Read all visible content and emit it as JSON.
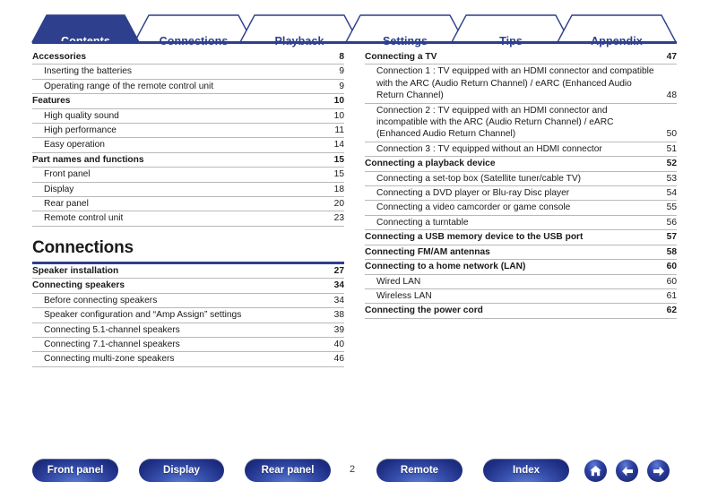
{
  "colors": {
    "brand_blue": "#2d3f8d",
    "rule_gray": "#b9b9b9",
    "text": "#1a1a1a",
    "tab_active_bg": "#2d3f8d",
    "tab_active_text": "#ffffff"
  },
  "tabs": [
    {
      "label": "Contents",
      "active": true
    },
    {
      "label": "Connections",
      "active": false
    },
    {
      "label": "Playback",
      "active": false
    },
    {
      "label": "Settings",
      "active": false
    },
    {
      "label": "Tips",
      "active": false
    },
    {
      "label": "Appendix",
      "active": false
    }
  ],
  "left_column": {
    "rows_top": [
      {
        "level": 1,
        "title": "Accessories",
        "page": "8"
      },
      {
        "level": 2,
        "title": "Inserting the batteries",
        "page": "9"
      },
      {
        "level": 2,
        "title": "Operating range of the remote control unit",
        "page": "9"
      },
      {
        "level": 1,
        "title": "Features",
        "page": "10"
      },
      {
        "level": 2,
        "title": "High quality sound",
        "page": "10"
      },
      {
        "level": 2,
        "title": "High performance",
        "page": "11"
      },
      {
        "level": 2,
        "title": "Easy operation",
        "page": "14"
      },
      {
        "level": 1,
        "title": "Part names and functions",
        "page": "15"
      },
      {
        "level": 2,
        "title": "Front panel",
        "page": "15"
      },
      {
        "level": 2,
        "title": "Display",
        "page": "18"
      },
      {
        "level": 2,
        "title": "Rear panel",
        "page": "20"
      },
      {
        "level": 2,
        "title": "Remote control unit",
        "page": "23"
      }
    ],
    "section_heading": "Connections",
    "rows_bottom": [
      {
        "level": 1,
        "title": "Speaker installation",
        "page": "27"
      },
      {
        "level": 1,
        "title": "Connecting speakers",
        "page": "34"
      },
      {
        "level": 2,
        "title": "Before connecting speakers",
        "page": "34"
      },
      {
        "level": 2,
        "title": "Speaker configuration and “Amp Assign” settings",
        "page": "38"
      },
      {
        "level": 2,
        "title": "Connecting 5.1-channel speakers",
        "page": "39"
      },
      {
        "level": 2,
        "title": "Connecting 7.1-channel speakers",
        "page": "40"
      },
      {
        "level": 2,
        "title": "Connecting multi-zone speakers",
        "page": "46"
      }
    ]
  },
  "right_column": {
    "rows": [
      {
        "level": 1,
        "title": "Connecting a TV",
        "page": "47"
      },
      {
        "level": 2,
        "title": "Connection 1 : TV equipped with an HDMI connector and compatible with the ARC (Audio Return Channel) / eARC (Enhanced Audio Return Channel)",
        "page": "48"
      },
      {
        "level": 2,
        "title": "Connection 2 : TV equipped with an HDMI connector and incompatible with the ARC (Audio Return Channel) / eARC (Enhanced Audio Return Channel)",
        "page": "50"
      },
      {
        "level": 2,
        "title": "Connection 3 : TV equipped without an HDMI connector",
        "page": "51"
      },
      {
        "level": 1,
        "title": "Connecting a playback device",
        "page": "52"
      },
      {
        "level": 2,
        "title": "Connecting a set-top box (Satellite tuner/cable TV)",
        "page": "53"
      },
      {
        "level": 2,
        "title": "Connecting a DVD player or Blu-ray Disc player",
        "page": "54"
      },
      {
        "level": 2,
        "title": "Connecting a video camcorder or game console",
        "page": "55"
      },
      {
        "level": 2,
        "title": "Connecting a turntable",
        "page": "56"
      },
      {
        "level": 1,
        "title": "Connecting a USB memory device to the USB port",
        "page": "57"
      },
      {
        "level": 1,
        "title": "Connecting FM/AM antennas",
        "page": "58"
      },
      {
        "level": 1,
        "title": "Connecting to a home network (LAN)",
        "page": "60"
      },
      {
        "level": 2,
        "title": "Wired LAN",
        "page": "60"
      },
      {
        "level": 2,
        "title": "Wireless LAN",
        "page": "61"
      },
      {
        "level": 1,
        "title": "Connecting the power cord",
        "page": "62"
      }
    ]
  },
  "footer": {
    "buttons": [
      {
        "label": "Front panel"
      },
      {
        "label": "Display"
      },
      {
        "label": "Rear panel"
      },
      {
        "label": "Remote"
      },
      {
        "label": "Index"
      }
    ],
    "page_number": "2",
    "nav_icons": [
      {
        "name": "home-icon"
      },
      {
        "name": "arrow-left-icon"
      },
      {
        "name": "arrow-right-icon"
      }
    ]
  }
}
